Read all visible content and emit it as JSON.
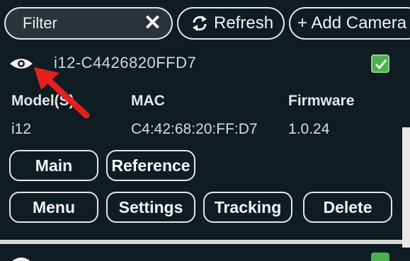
{
  "toolbar": {
    "filter_placeholder": "Filter",
    "refresh_label": "Refresh",
    "add_camera_label": "+ Add Camera"
  },
  "camera": {
    "name": "i12-C4426820FFD7",
    "enabled": true,
    "headers": {
      "model": "Model(S)",
      "mac": "MAC",
      "firmware": "Firmware"
    },
    "values": {
      "model": "i12",
      "mac": "C4:42:68:20:FF:D7",
      "firmware": "1.0.24"
    },
    "buttons": {
      "main": "Main",
      "reference": "Reference",
      "menu": "Menu",
      "settings": "Settings",
      "tracking": "Tracking",
      "delete": "Delete"
    }
  },
  "colors": {
    "panel_bg": "#0f1c22",
    "accent_check": "#4caf50",
    "annotation_arrow": "#e3201b"
  },
  "icons": {
    "visibility": "eye-icon",
    "close": "close-icon",
    "refresh": "refresh-icon",
    "enabled": "checkbox-icon",
    "annotation": "red-arrow"
  }
}
